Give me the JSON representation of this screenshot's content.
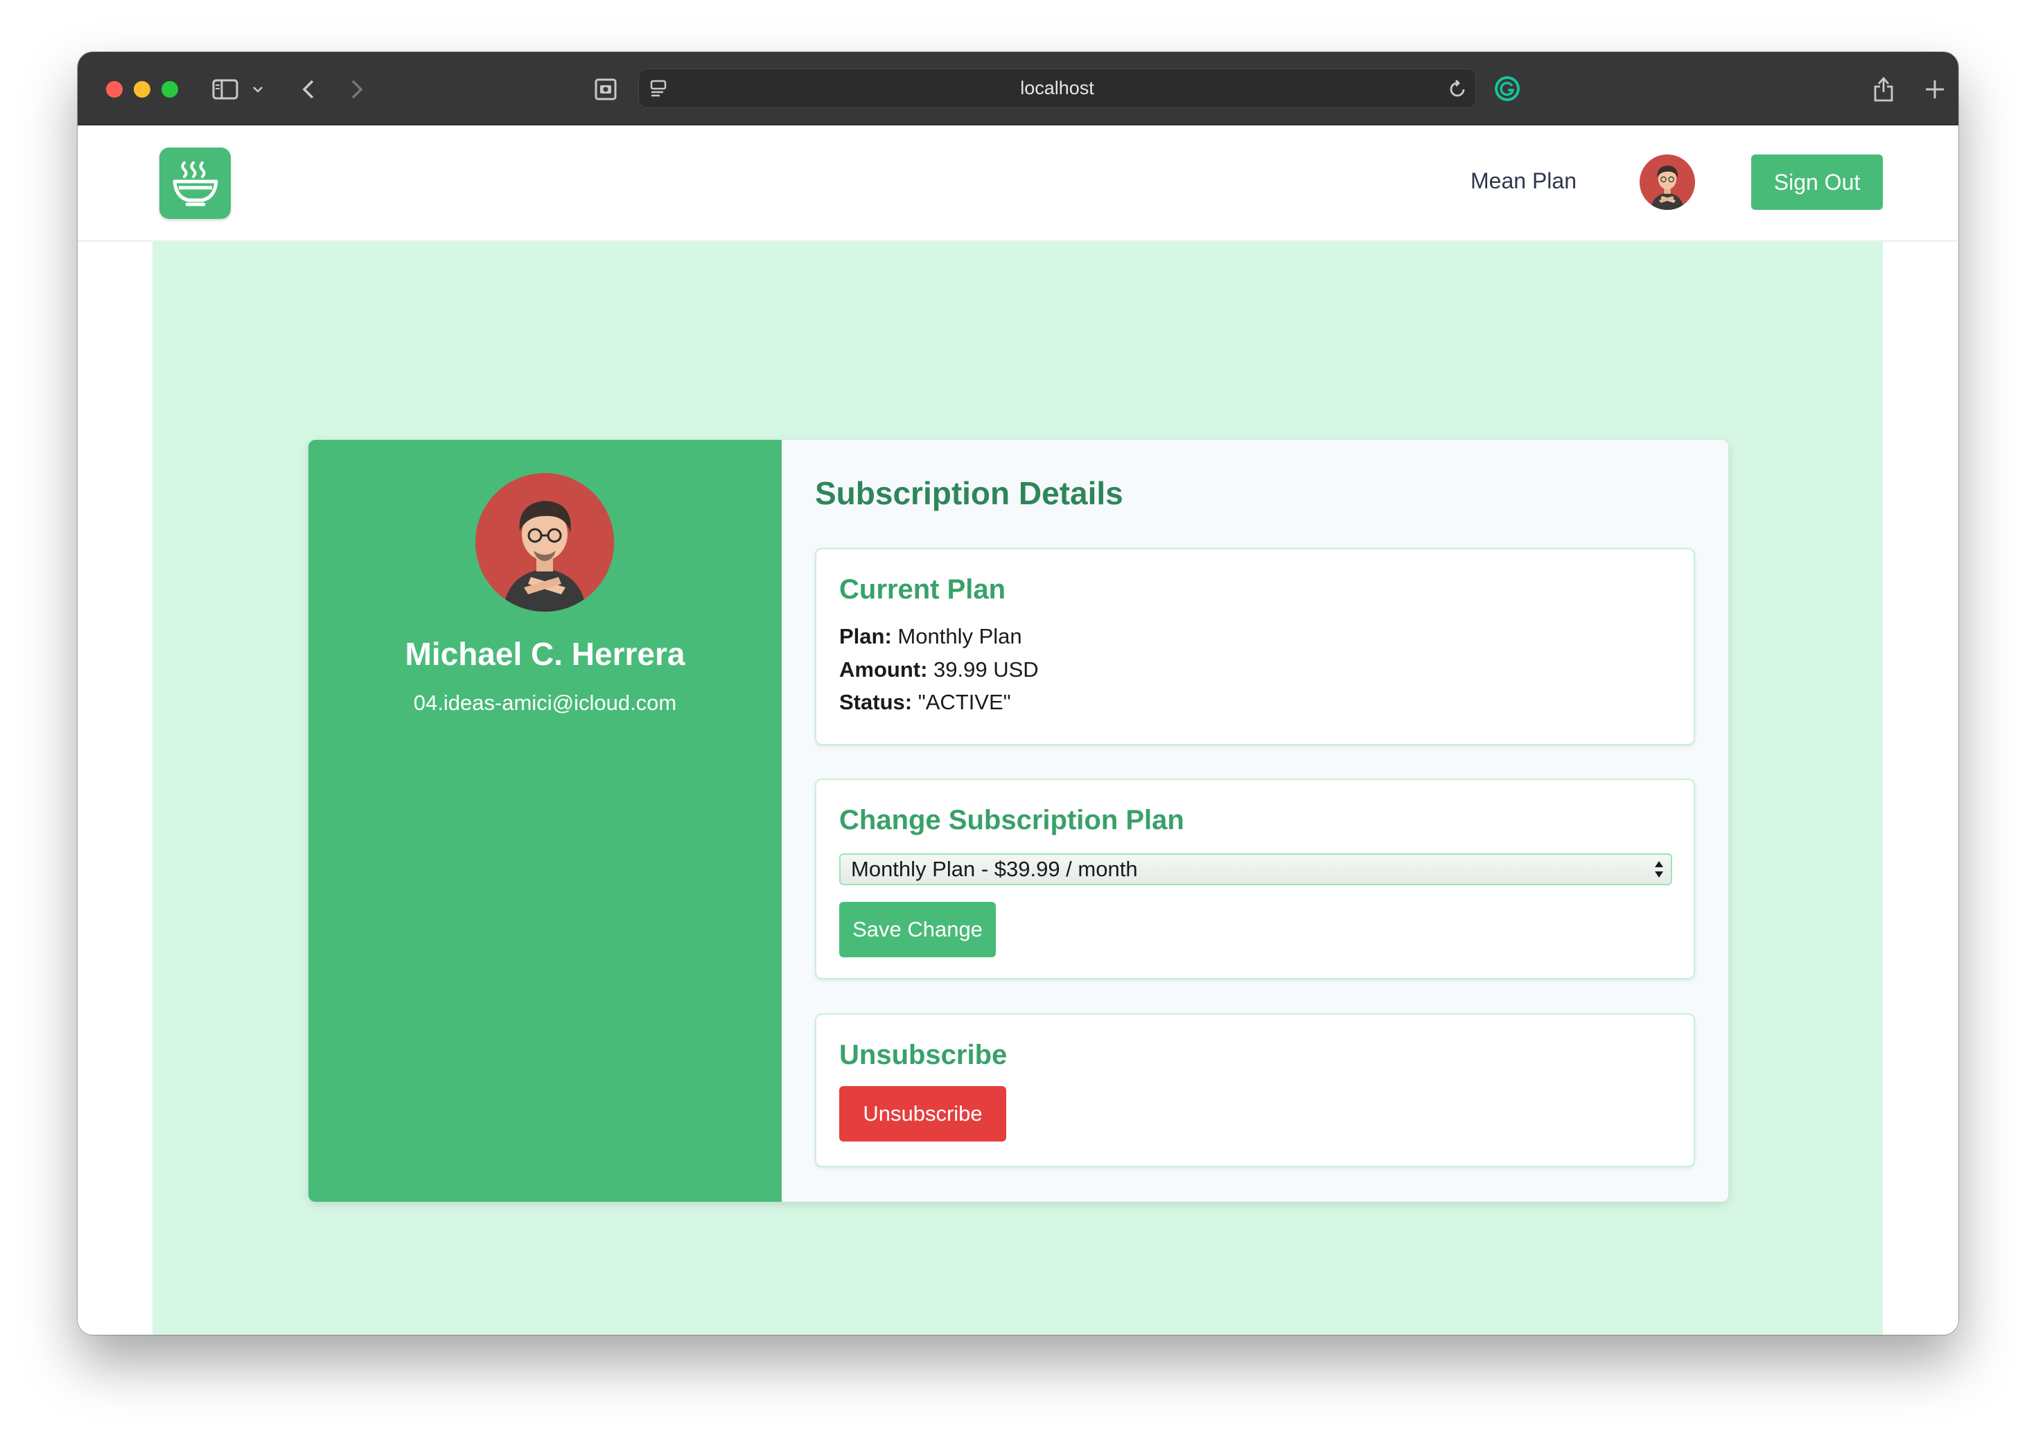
{
  "browser": {
    "address": "localhost",
    "icons": [
      "sidebar-icon",
      "chevron-down-icon",
      "back-icon",
      "forward-icon",
      "screenshot-icon",
      "page-settings-icon",
      "reload-icon",
      "grammarly-icon",
      "share-icon",
      "new-tab-icon",
      "tab-overview-icon"
    ]
  },
  "navbar": {
    "logo_icon": "soup-bowl-icon",
    "link_label": "Mean Plan",
    "signout_label": "Sign Out"
  },
  "profile": {
    "name": "Michael C. Herrera",
    "email": "04.ideas-amici@icloud.com"
  },
  "details": {
    "title": "Subscription Details",
    "current_plan": {
      "title": "Current Plan",
      "plan_label": "Plan:",
      "plan_value": " Monthly Plan",
      "amount_label": "Amount:",
      "amount_value": " 39.99 USD",
      "status_label": "Status:",
      "status_value": " \"ACTIVE\""
    },
    "change_plan": {
      "title": "Change Subscription Plan",
      "selected_option": "Monthly Plan - $39.99 / month",
      "save_label": "Save Change"
    },
    "unsubscribe": {
      "title": "Unsubscribe",
      "button_label": "Unsubscribe"
    }
  },
  "colors": {
    "brand_green": "#48bb78",
    "heading_green": "#2f855a",
    "danger_red": "#e53e3e",
    "content_bg": "#d7f7e5"
  }
}
